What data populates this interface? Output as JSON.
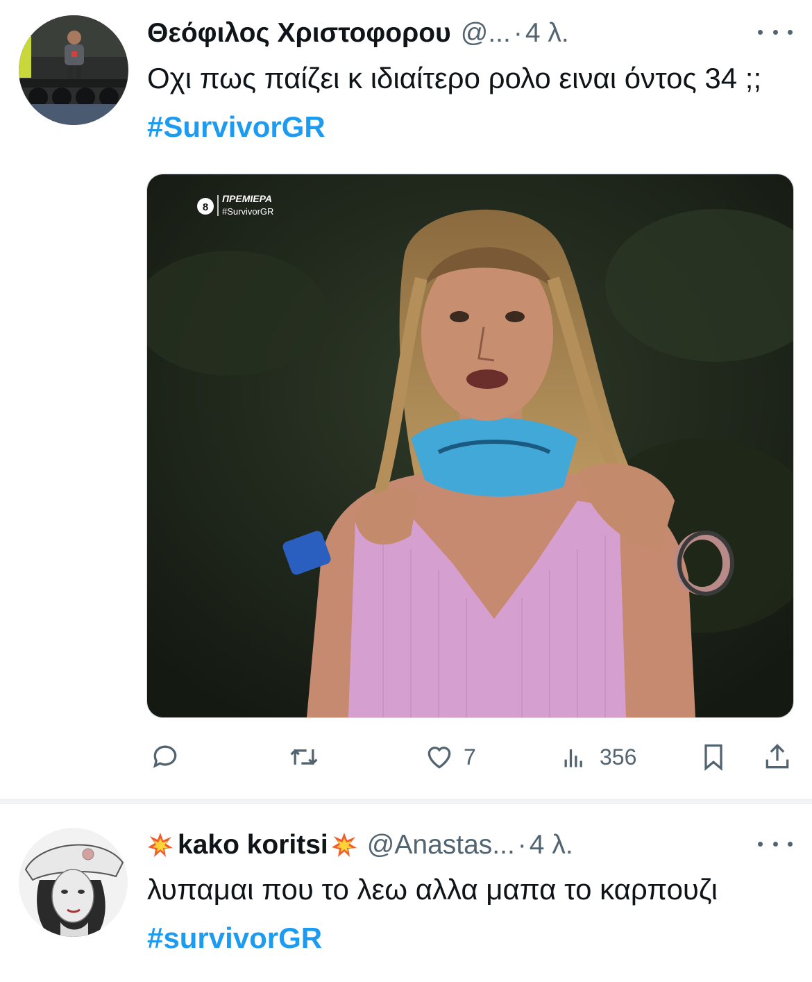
{
  "tweets": [
    {
      "name": "Θεόφιλος Χριστοφορου",
      "handle": "@...",
      "separator": "·",
      "time": "4 λ.",
      "text": "Οχι πως παίζει κ ιδιαίτερο ρολο ειναι όντος 34 ;; ",
      "hashtag": "#SurvivorGR",
      "media": {
        "badge_channel": "8",
        "badge_title": "ΠΡΕΜΙΕΡΑ",
        "badge_tag": "#SurvivorGR"
      },
      "actions": {
        "reply": "",
        "retweet": "",
        "likes": "7",
        "views": "356"
      }
    },
    {
      "name": "kako koritsi",
      "handle": "@Anastas...",
      "separator": "·",
      "time": "4 λ.",
      "text": "λυπαμαι που το λεω αλλα μαπα το καρπουζι ",
      "hashtag": "#survivorGR"
    }
  ],
  "colors": {
    "accent": "#1d9bf0",
    "secondary_text": "#536471",
    "text": "#0f1419"
  },
  "icons": [
    "more-icon",
    "reply-icon",
    "retweet-icon",
    "like-icon",
    "views-icon",
    "bookmark-icon",
    "share-icon",
    "collision-emoji-icon"
  ]
}
